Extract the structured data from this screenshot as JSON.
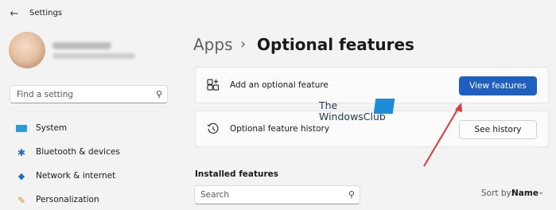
{
  "window": {
    "title": "Settings",
    "back_icon": "back-arrow-icon"
  },
  "sidebar": {
    "search": {
      "placeholder": "Find a setting",
      "icon": "search-icon"
    },
    "items": [
      {
        "label": "System",
        "icon": "system-icon",
        "color": "#2b9bd6"
      },
      {
        "label": "Bluetooth & devices",
        "icon": "bluetooth-icon",
        "color": "#1b6fc4"
      },
      {
        "label": "Network & internet",
        "icon": "wifi-icon",
        "color": "#1b6fc4"
      },
      {
        "label": "Personalization",
        "icon": "paintbrush-icon",
        "color": "#d08a3a"
      }
    ]
  },
  "breadcrumb": {
    "parent": "Apps",
    "separator": "›",
    "current": "Optional features"
  },
  "cards": {
    "add": {
      "text": "Add an optional feature",
      "button": "View features",
      "icon": "add-grid-icon"
    },
    "history": {
      "text": "Optional feature history",
      "button": "See history",
      "icon": "history-icon"
    }
  },
  "watermark": {
    "line1": "The",
    "line2": "WindowsClub"
  },
  "installed": {
    "heading": "Installed features",
    "search_placeholder": "Search",
    "sort_label": "Sort by:",
    "sort_value": "Name"
  },
  "colors": {
    "accent": "#1f5fbf",
    "annotation_arrow": "#d9383f"
  }
}
